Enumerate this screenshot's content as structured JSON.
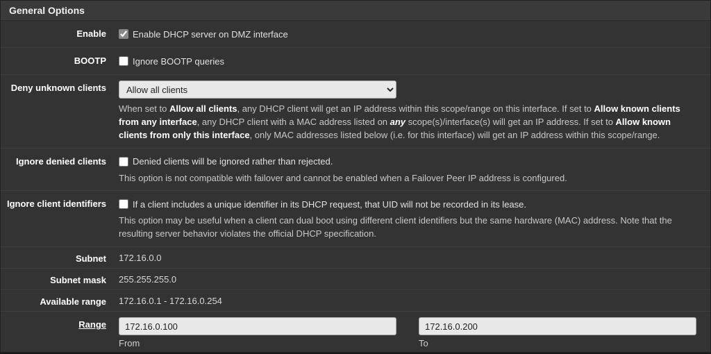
{
  "panel": {
    "title": "General Options"
  },
  "rows": {
    "enable": {
      "label": "Enable",
      "checked": true,
      "cb_label": "Enable DHCP server on DMZ interface"
    },
    "bootp": {
      "label": "BOOTP",
      "checked": false,
      "cb_label": "Ignore BOOTP queries"
    },
    "deny_unknown": {
      "label": "Deny unknown clients",
      "selected": "Allow all clients",
      "help_pre": "When set to ",
      "help_b1": "Allow all clients",
      "help_mid1": ", any DHCP client will get an IP address within this scope/range on this interface. If set to ",
      "help_b2": "Allow known clients from any interface",
      "help_mid2": ", any DHCP client with a MAC address listed on ",
      "help_i_any": "any",
      "help_mid3": " scope(s)/interface(s) will get an IP address. If set to ",
      "help_b3": "Allow known clients from only this interface",
      "help_end": ", only MAC addresses listed below (i.e. for this interface) will get an IP address within this scope/range."
    },
    "ignore_denied": {
      "label": "Ignore denied clients",
      "checked": false,
      "cb_label": "Denied clients will be ignored rather than rejected.",
      "help": "This option is not compatible with failover and cannot be enabled when a Failover Peer IP address is configured."
    },
    "ignore_client_ids": {
      "label": "Ignore client identifiers",
      "checked": false,
      "cb_label": "If a client includes a unique identifier in its DHCP request, that UID will not be recorded in its lease.",
      "help": "This option may be useful when a client can dual boot using different client identifiers but the same hardware (MAC) address. Note that the resulting server behavior violates the official DHCP specification."
    },
    "subnet": {
      "label": "Subnet",
      "value": "172.16.0.0"
    },
    "subnet_mask": {
      "label": "Subnet mask",
      "value": "255.255.255.0"
    },
    "available_range": {
      "label": "Available range",
      "value": "172.16.0.1 - 172.16.0.254"
    },
    "range": {
      "label": "Range",
      "from_value": "172.16.0.100",
      "from_label": "From",
      "to_value": "172.16.0.200",
      "to_label": "To"
    }
  }
}
